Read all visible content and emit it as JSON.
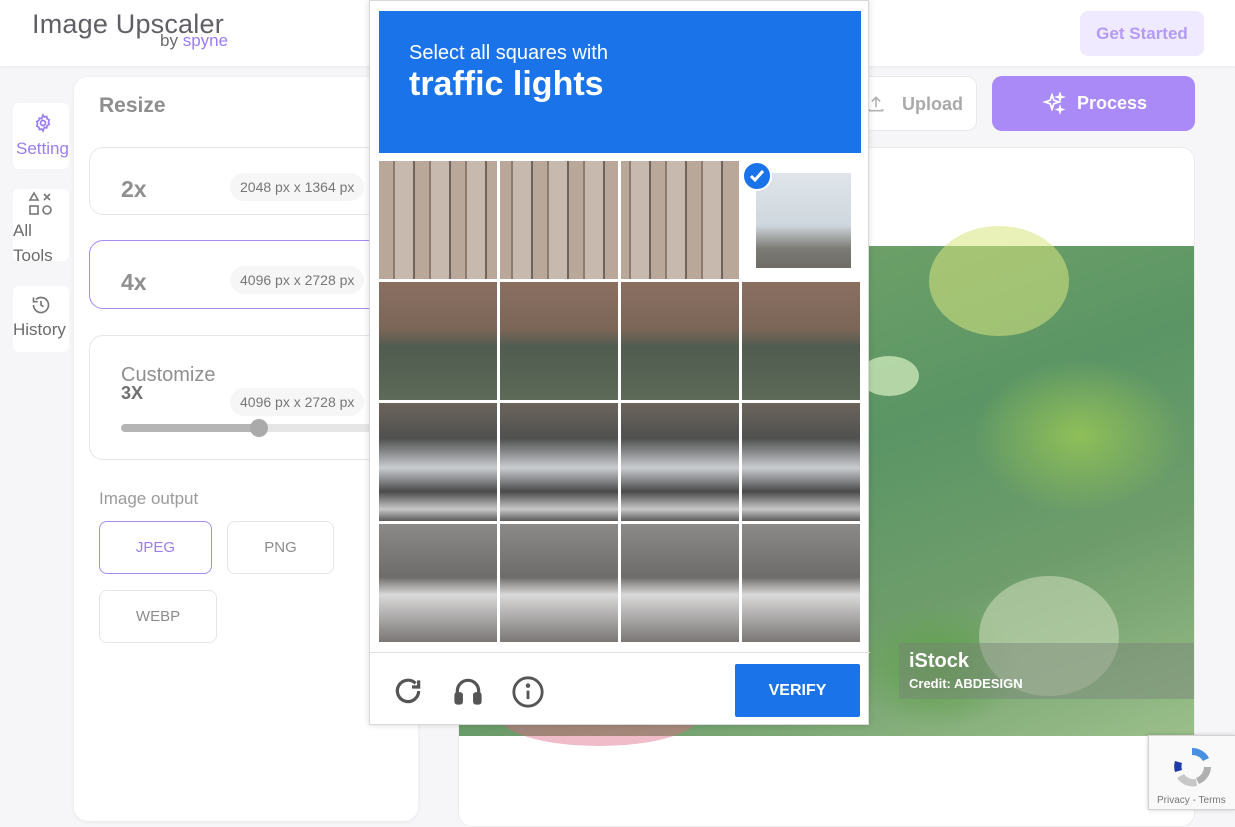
{
  "header": {
    "logo_title": "Image Upscaler",
    "logo_by": "by",
    "logo_brand": "spyne",
    "get_started": "Get Started"
  },
  "siderail": {
    "setting": "Setting",
    "all_tools_1": "All",
    "all_tools_2": "Tools",
    "history": "History"
  },
  "resize": {
    "title": "Resize",
    "options": [
      {
        "label": "2x",
        "dims": "2048 px x 1364 px",
        "selected": false
      },
      {
        "label": "4x",
        "dims": "4096 px x 2728 px",
        "selected": true
      }
    ],
    "customize": {
      "label": "Customize",
      "value": "3X",
      "dims": "4096 px x 2728 px",
      "slider_fraction": 0.55
    }
  },
  "output": {
    "label": "Image output",
    "formats": [
      "JPEG",
      "PNG",
      "WEBP"
    ],
    "selected": "JPEG"
  },
  "toolbar": {
    "upload": "Upload",
    "process": "Process"
  },
  "preview": {
    "watermark_brand": "iStock",
    "watermark_credit": "Credit: ABDESIGN"
  },
  "captcha": {
    "instruction": "Select all squares with",
    "object": "traffic lights",
    "verify": "VERIFY",
    "selected_tiles": [
      3
    ]
  },
  "recaptcha_badge": {
    "privacy": "Privacy",
    "separator": " - ",
    "terms": "Terms"
  },
  "colors": {
    "accent": "#a98af7",
    "captcha_blue": "#1a73e8"
  }
}
